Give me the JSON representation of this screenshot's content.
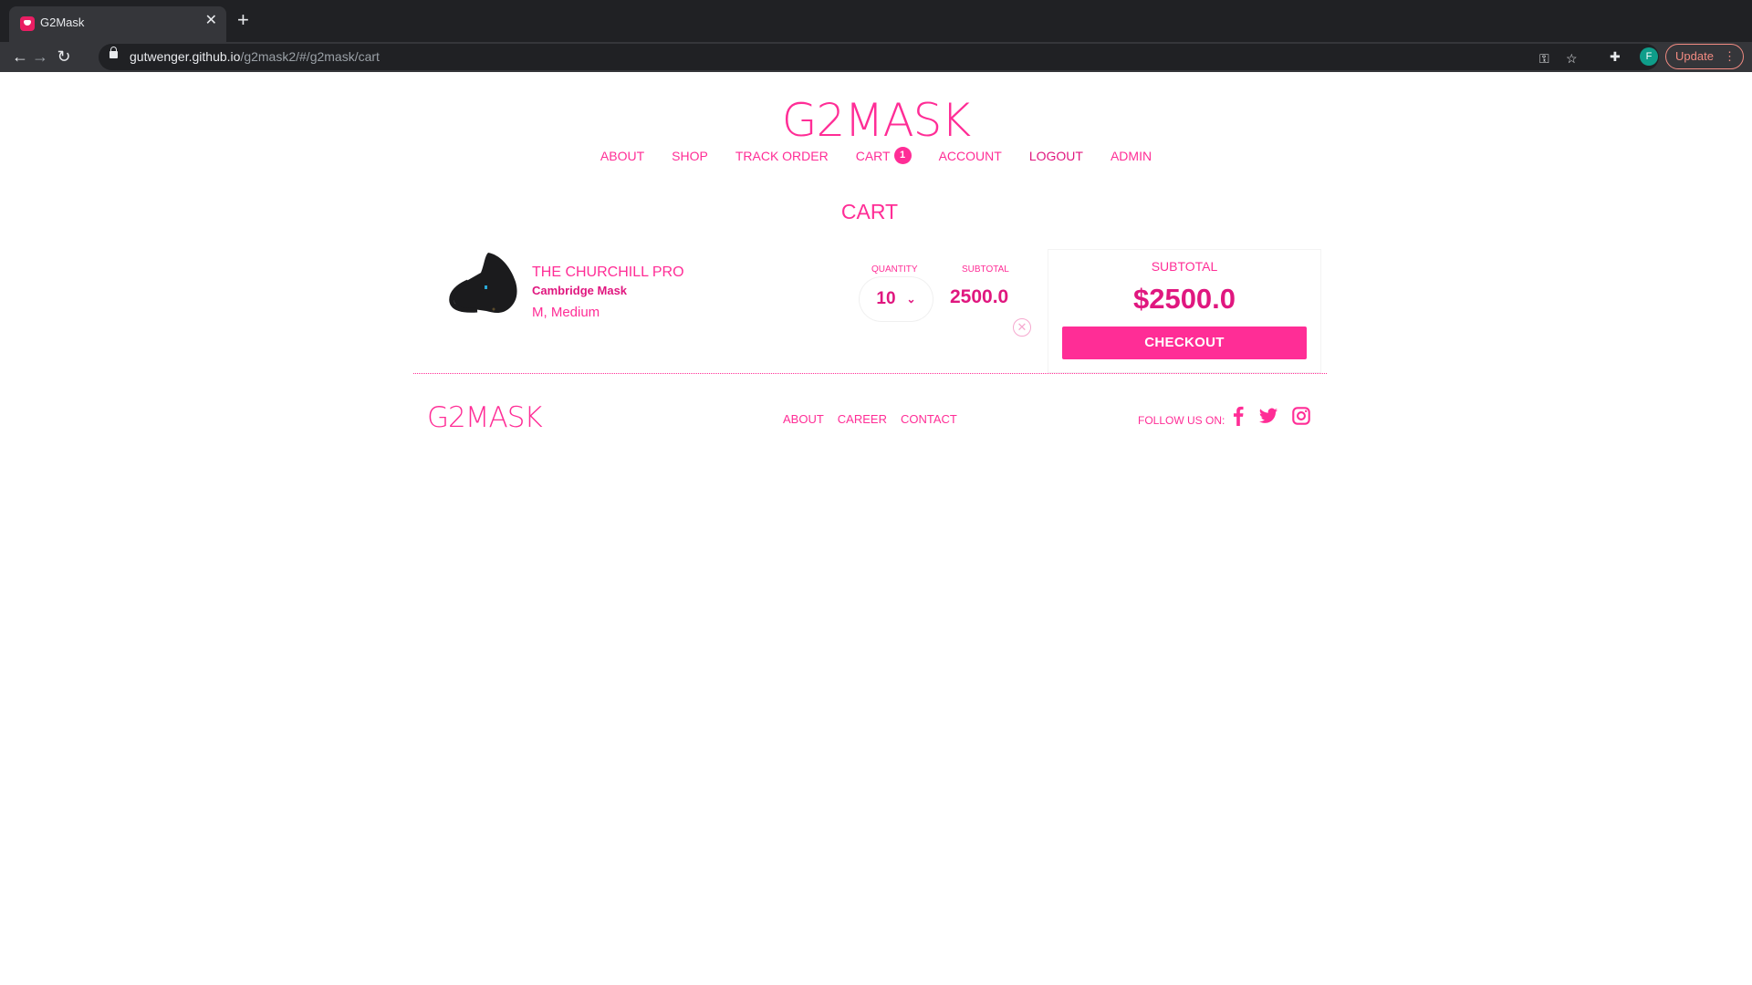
{
  "browser": {
    "tab_title": "G2Mask",
    "url_host": "gutwenger.github.io",
    "url_path": "/g2mask2/#/g2mask/cart",
    "profile_initial": "F",
    "update_label": "Update"
  },
  "site": {
    "brand": "G2MASK",
    "nav": {
      "about": "ABOUT",
      "shop": "SHOP",
      "track_order": "TRACK ORDER",
      "cart": "CART",
      "cart_count": "1",
      "account": "ACCOUNT",
      "logout": "LOGOUT",
      "admin": "ADMIN"
    },
    "accent_color": "#ff2d96"
  },
  "cart": {
    "title": "CART",
    "items": [
      {
        "name": "THE CHURCHILL PRO",
        "brand": "Cambridge Mask",
        "variant": "M, Medium",
        "quantity_label": "QUANTITY",
        "quantity": "10",
        "subtotal_label": "SUBTOTAL",
        "subtotal": "2500.0"
      }
    ],
    "summary": {
      "label": "SUBTOTAL",
      "total": "$2500.0",
      "checkout_label": "CHECKOUT"
    }
  },
  "footer": {
    "brand": "G2MASK",
    "links": {
      "about": "ABOUT",
      "career": "CAREER",
      "contact": "CONTACT"
    },
    "follow_label": "FOLLOW US ON:",
    "social_icons": [
      "facebook-icon",
      "twitter-icon",
      "instagram-icon"
    ]
  }
}
